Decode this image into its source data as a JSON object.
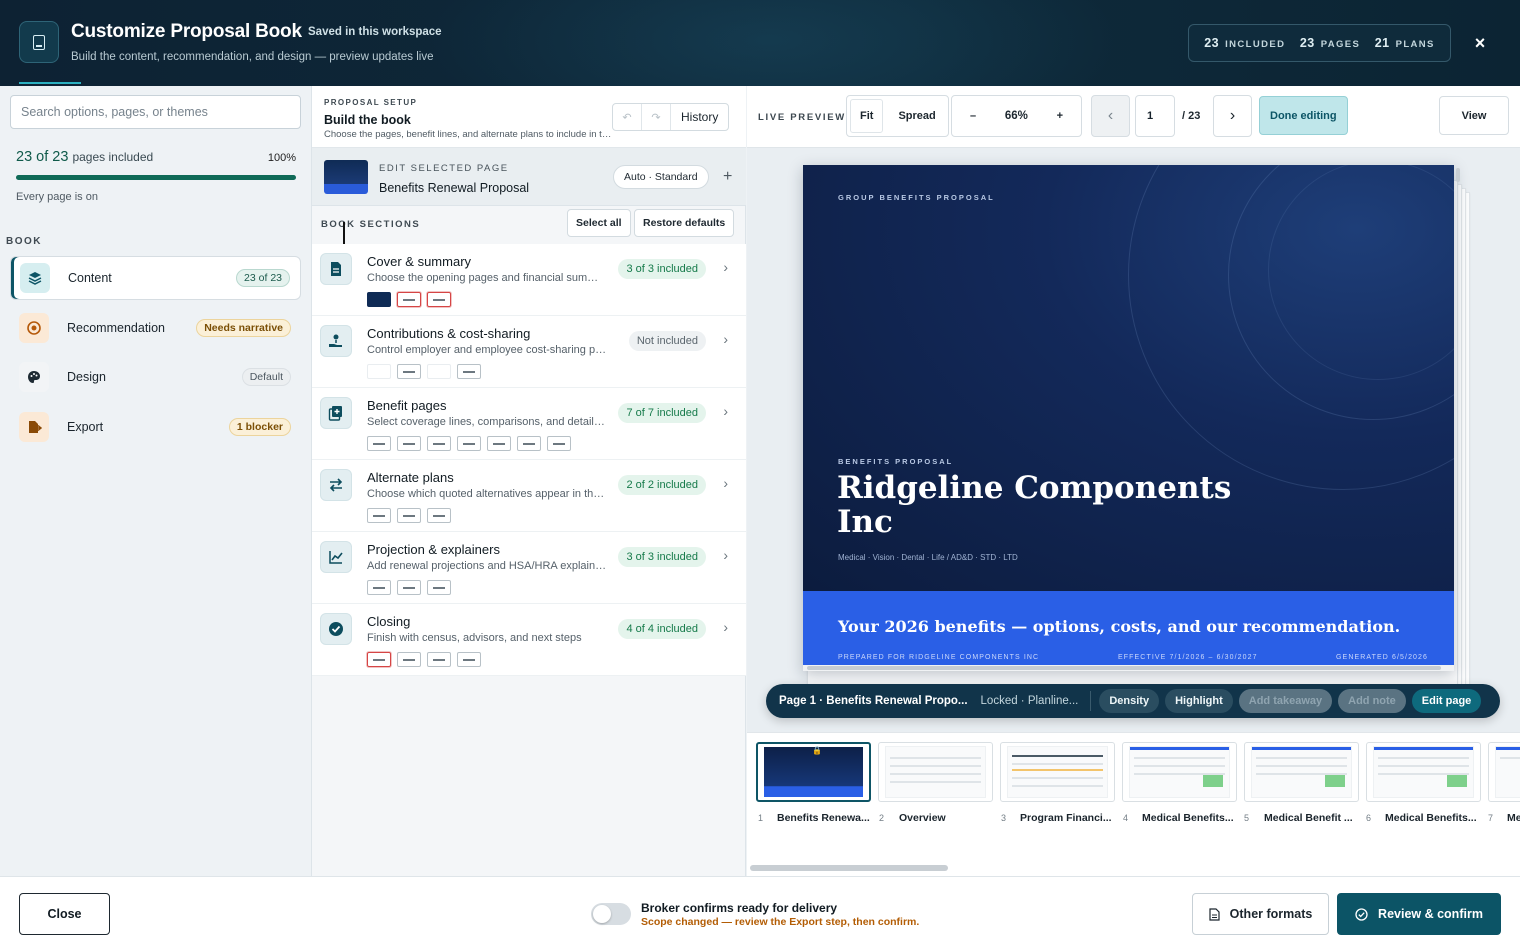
{
  "header": {
    "title": "Customize Proposal Book",
    "saved": "Saved in this workspace",
    "subtitle": "Build the content, recommendation, and design — preview updates live",
    "stats": [
      {
        "n": "23",
        "label": "INCLUDED"
      },
      {
        "n": "23",
        "label": "PAGES"
      },
      {
        "n": "21",
        "label": "PLANS"
      }
    ],
    "close_label": "×"
  },
  "sidebar": {
    "search_placeholder": "Search options, pages, or themes",
    "progress_count": "23 of 23",
    "progress_suffix": "pages included",
    "progress_pct": "100%",
    "progress_fraction": 1.0,
    "progress_note": "Every page is on",
    "book_label": "BOOK",
    "items": [
      {
        "label": "Content",
        "badge": "23 of 23"
      },
      {
        "label": "Recommendation",
        "badge": "Needs narrative"
      },
      {
        "label": "Design",
        "badge": "Default"
      },
      {
        "label": "Export",
        "badge": "1 blocker"
      }
    ]
  },
  "setup": {
    "kicker": "PROPOSAL SETUP",
    "title": "Build the book",
    "desc": "Choose the pages, benefit lines, and alternate plans to include in the proposal book.",
    "history_label": "History"
  },
  "selected_page": {
    "kicker": "EDIT SELECTED PAGE",
    "title": "Benefits Renewal Proposal",
    "mode": "Auto · Standard",
    "add_label": "+"
  },
  "sections_bar": {
    "kicker": "BOOK SECTIONS",
    "select_all": "Select all",
    "restore": "Restore defaults"
  },
  "sections": [
    {
      "title": "Cover & summary",
      "desc": "Choose the opening pages and financial summary",
      "status": "3 of 3 included"
    },
    {
      "title": "Contributions & cost-sharing",
      "desc": "Control employer and employee cost-sharing pages",
      "status": "Not included"
    },
    {
      "title": "Benefit pages",
      "desc": "Select coverage lines, comparisons, and detail pages",
      "status": "7 of 7 included"
    },
    {
      "title": "Alternate plans",
      "desc": "Choose which quoted alternatives appear in the book",
      "status": "2 of 2 included"
    },
    {
      "title": "Projection & explainers",
      "desc": "Add renewal projections and HSA/HRA explainers",
      "status": "3 of 3 included"
    },
    {
      "title": "Closing",
      "desc": "Finish with census, advisors, and next steps",
      "status": "4 of 4 included"
    }
  ],
  "preview_toolbar": {
    "kicker": "LIVE PREVIEW",
    "fit": "Fit",
    "spread": "Spread",
    "zoom_minus": "–",
    "zoom": "66%",
    "zoom_plus": "+",
    "prev": "‹",
    "page": "1",
    "total": "/ 23",
    "next": "›",
    "done": "Done editing",
    "view": "View"
  },
  "cover": {
    "kicker_top": "GROUP BENEFITS PROPOSAL",
    "kicker_mid": "BENEFITS PROPOSAL",
    "company": "Ridgeline Components Inc",
    "lines": "Medical · Vision · Dental · Life / AD&D · STD · LTD",
    "tagline": "Your 2026 benefits — options, costs, and our recommendation.",
    "prepared": "PREPARED FOR RIDGELINE COMPONENTS INC",
    "effective": "EFFECTIVE 7/1/2026 – 6/30/2027",
    "generated": "GENERATED 6/5/2026"
  },
  "float_bar": {
    "title": "Page 1 · Benefits Renewal Propo...",
    "lock": "Locked · Planline...",
    "density": "Density",
    "highlight": "Highlight",
    "takeaway": "Add takeaway",
    "note": "Add note",
    "edit": "Edit page"
  },
  "thumbnails": [
    {
      "num": "1",
      "label": "Benefits Renewa..."
    },
    {
      "num": "2",
      "label": "Overview"
    },
    {
      "num": "3",
      "label": "Program Financi..."
    },
    {
      "num": "4",
      "label": "Medical Benefits..."
    },
    {
      "num": "5",
      "label": "Medical Benefit ..."
    },
    {
      "num": "6",
      "label": "Medical Benefits..."
    },
    {
      "num": "7",
      "label": "Me"
    }
  ],
  "footer": {
    "close": "Close",
    "confirm_title": "Broker confirms ready for delivery",
    "confirm_warn": "Scope changed — review the Export step, then confirm.",
    "other": "Other formats",
    "review": "Review & confirm"
  },
  "colors": {
    "accent": "#0c5466",
    "cover_navy": "#13295a",
    "cover_band": "#2a5fe6",
    "included_green": "#157a4a",
    "warning_amber": "#b35d05"
  }
}
